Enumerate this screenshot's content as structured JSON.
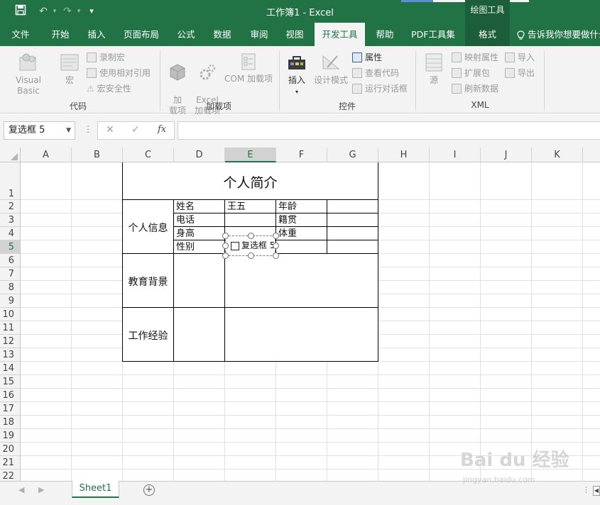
{
  "window": {
    "title": "工作簿1  -  Excel",
    "context_header": "绘图工具"
  },
  "tabs": [
    "文件",
    "开始",
    "插入",
    "页面布局",
    "公式",
    "数据",
    "审阅",
    "视图",
    "开发工具",
    "帮助",
    "PDF工具集",
    "格式"
  ],
  "active_tab": "开发工具",
  "tell_me": "告诉我你想要做什么",
  "ribbon": {
    "code_group": {
      "label": "代码",
      "visual_basic": "Visual Basic",
      "macros": "宏",
      "record_macro": "录制宏",
      "relative_refs": "使用相对引用",
      "macro_security": "宏安全性"
    },
    "addins_group": {
      "label": "加载项",
      "addins": "加\n载项",
      "excel_addins": "Excel\n加载项",
      "com_addins": "COM 加载项"
    },
    "controls_group": {
      "label": "控件",
      "insert": "插入",
      "design_mode": "设计模式",
      "properties": "属性",
      "view_code": "查看代码",
      "run_dialog": "运行对话框"
    },
    "xml_group": {
      "label": "XML",
      "source": "源",
      "map_properties": "映射属性",
      "expansion_packs": "扩展包",
      "refresh_data": "刷新数据",
      "import": "导入",
      "export": "导出"
    }
  },
  "formula_bar": {
    "name_box": "复选框 5",
    "cancel": "✕",
    "enter": "✓",
    "fx": "fx",
    "formula": ""
  },
  "columns": [
    "A",
    "B",
    "C",
    "D",
    "E",
    "F",
    "G",
    "H",
    "I",
    "J",
    "K"
  ],
  "selected_column": "E",
  "rows": [
    "1",
    "2",
    "3",
    "4",
    "5",
    "6",
    "7",
    "8",
    "9",
    "10",
    "11",
    "12",
    "13",
    "14",
    "15",
    "16",
    "17",
    "18",
    "19",
    "20",
    "21",
    "22"
  ],
  "selected_row": "5",
  "sheet": {
    "title": "个人简介",
    "section_personal": "个人信息",
    "section_education": "教育背景",
    "section_work": "工作经验",
    "name_label": "姓名",
    "name_value": "王五",
    "age_label": "年龄",
    "phone_label": "电话",
    "origin_label": "籍贯",
    "height_label": "身高",
    "weight_label": "体重",
    "gender_label": "性别",
    "checkbox_label": "复选框 5"
  },
  "sheet_tabs": [
    "Sheet1"
  ],
  "watermark": {
    "logo": "Bai du 经验",
    "url": "jingyan.baidu.com"
  }
}
